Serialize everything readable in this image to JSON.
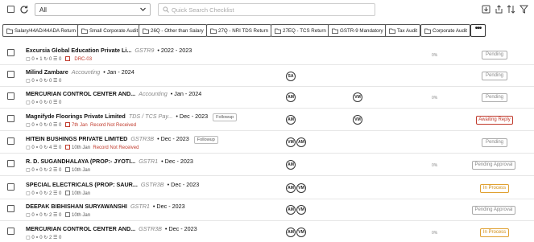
{
  "toolbar": {
    "filter_value": "All",
    "search_placeholder": "Quick Search Checklist"
  },
  "chips": [
    {
      "label": "Salary/44AD/44ADA Return"
    },
    {
      "label": "Small Corporate Audit"
    },
    {
      "label": "26Q - Other than Salary"
    },
    {
      "label": "27Q - NRI TDS Return"
    },
    {
      "label": "27EQ - TCS Return"
    },
    {
      "label": "GSTR-9 Mandatory"
    },
    {
      "label": "Tax Audit"
    },
    {
      "label": "Corporate Audit"
    }
  ],
  "more_label": "•••",
  "rows": [
    {
      "name": "Excursia Global Education Private Li...",
      "type": "GSTR9",
      "period": "2022 - 2023",
      "followup": "",
      "counts": "▢ 0  ⭑ 1  ↻ 0  ☰ 0",
      "due": "",
      "due_extra": "DRC-03",
      "assignees": [],
      "progress": "0%",
      "status": "Pending",
      "status_style": ""
    },
    {
      "name": "Milind Zambare",
      "type": "Accounting",
      "period": "Jan - 2024",
      "followup": "",
      "counts": "▢ 0  ⭑ 0  ↻ 0  ☰ 0",
      "due": "",
      "due_extra": "",
      "assignees": [
        "SA"
      ],
      "progress": "",
      "status": "Pending",
      "status_style": ""
    },
    {
      "name": "MERCURIAN CONTROL CENTER AND...",
      "type": "Accounting",
      "period": "Jan - 2024",
      "followup": "",
      "counts": "▢ 0  ⭑ 0  ↻ 0  ☰ 0",
      "due": "",
      "due_extra": "",
      "assignees": [
        "AM",
        "VM"
      ],
      "progress": "0%",
      "status": "Pending",
      "status_style": ""
    },
    {
      "name": "Magnifyde Floorings Private Limited",
      "type": "TDS / TCS Pay...",
      "period": "Dec - 2023",
      "followup": "Followup",
      "counts": "▢ 0  ⭑ 0  ↻ 0  ☰ 0",
      "due": "7th Jan",
      "due_extra": "Record Not Received",
      "assignees": [
        "AM",
        "VM"
      ],
      "progress": "",
      "status": "Awaiting Reply",
      "status_style": "red"
    },
    {
      "name": "HITEIN BUSHINGS PRIVATE LIMITED",
      "type": "GSTR3B",
      "period": "Dec - 2023",
      "followup": "Followup",
      "counts": "▢ 0  ⭑ 0  ↻ 4  ☰ 0",
      "due": "10th Jan",
      "due_extra": "Record Not Received",
      "assignees": [
        "VM",
        "AM"
      ],
      "progress": "",
      "status": "Pending",
      "status_style": ""
    },
    {
      "name": "R. D. SUGANDHALAYA (PROP:- JYOTI...",
      "type": "GSTR1",
      "period": "Dec - 2023",
      "followup": "",
      "counts": "▢ 0  ⭑ 0  ↻ 2  ☰ 0",
      "due": "10th Jan",
      "due_extra": "",
      "assignees": [
        "AM"
      ],
      "progress": "0%",
      "status": "Pending Approval",
      "status_style": ""
    },
    {
      "name": "SPECIAL ELECTRICALS (PROP: SAUR...",
      "type": "GSTR3B",
      "period": "Dec - 2023",
      "followup": "",
      "counts": "▢ 0  ⭑ 0  ↻ 2  ☰ 0",
      "due": "10th Jan",
      "due_extra": "",
      "assignees": [
        "AM",
        "VM"
      ],
      "progress": "",
      "status": "In Process",
      "status_style": "orange"
    },
    {
      "name": "DEEPAK BIBHISHAN SURYAWANSHI",
      "type": "GSTR1",
      "period": "Dec - 2023",
      "followup": "",
      "counts": "▢ 0  ⭑ 0  ↻ 2  ☰ 0",
      "due": "10th Jan",
      "due_extra": "",
      "assignees": [
        "AM",
        "VM"
      ],
      "progress": "",
      "status": "Pending Approval",
      "status_style": ""
    },
    {
      "name": "MERCURIAN CONTROL CENTER AND...",
      "type": "GSTR3B",
      "period": "Dec - 2023",
      "followup": "",
      "counts": "▢ 0  ⭑ 0  ↻ 2  ☰ 0",
      "due": "",
      "due_extra": "",
      "assignees": [
        "AM",
        "VM"
      ],
      "progress": "0%",
      "status": "In Process",
      "status_style": "orange"
    }
  ]
}
